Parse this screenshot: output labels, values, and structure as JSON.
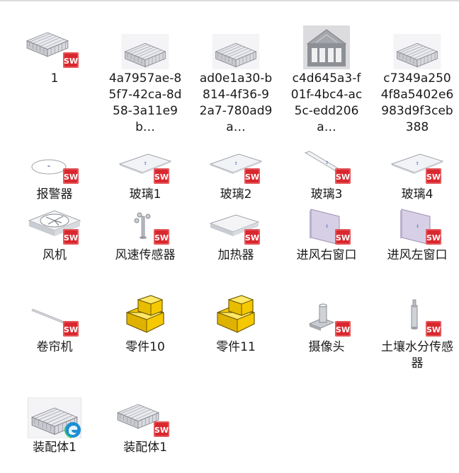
{
  "files": [
    {
      "id": "f1",
      "label": "1",
      "icon": "greenhouse-sw-icon"
    },
    {
      "id": "f2",
      "label": "4a7957ae-85f7-42ca-8d58-3a11e9b…",
      "icon": "greenhouse-thumbnail"
    },
    {
      "id": "f3",
      "label": "ad0e1a30-b814-4f36-92a7-780ad9a…",
      "icon": "greenhouse-thumbnail"
    },
    {
      "id": "f4",
      "label": "c4d645a3-f01f-4bc4-ac5c-edd206a…",
      "icon": "house-front-thumbnail"
    },
    {
      "id": "f5",
      "label": "c7349a2504f8a5402e6983d9f3ceb388",
      "icon": "greenhouse-thumbnail"
    },
    {
      "id": "f6",
      "label": "报警器",
      "icon": "alarm-sw-icon"
    },
    {
      "id": "f7",
      "label": "玻璃1",
      "icon": "glass-sw-icon"
    },
    {
      "id": "f8",
      "label": "玻璃2",
      "icon": "glass-sw-icon"
    },
    {
      "id": "f9",
      "label": "玻璃3",
      "icon": "glass-sw-icon"
    },
    {
      "id": "f10",
      "label": "玻璃4",
      "icon": "glass-sw-icon"
    },
    {
      "id": "f11",
      "label": "风机",
      "icon": "fan-sw-icon"
    },
    {
      "id": "f12",
      "label": "风速传感器",
      "icon": "wind-sensor-sw-icon"
    },
    {
      "id": "f13",
      "label": "加热器",
      "icon": "heater-sw-icon"
    },
    {
      "id": "f14",
      "label": "进风右窗口",
      "icon": "window-sw-icon"
    },
    {
      "id": "f15",
      "label": "进风左窗口",
      "icon": "window-sw-icon"
    },
    {
      "id": "f16",
      "label": "卷帘机",
      "icon": "rod-sw-icon"
    },
    {
      "id": "f17",
      "label": "零件10",
      "icon": "part-yellow-icon"
    },
    {
      "id": "f18",
      "label": "零件11",
      "icon": "part-yellow-icon"
    },
    {
      "id": "f19",
      "label": "摄像头",
      "icon": "camera-sw-icon"
    },
    {
      "id": "f20",
      "label": "土壤水分传感器",
      "icon": "soil-sensor-sw-icon"
    },
    {
      "id": "f21",
      "label": "装配体1",
      "icon": "greenhouse-edge-icon"
    },
    {
      "id": "f22",
      "label": "装配体1",
      "icon": "greenhouse-sw-icon"
    }
  ],
  "colors": {
    "sw_red": "#d9272e",
    "part_yellow": "#f5c800",
    "text": "#1a1a1a"
  }
}
